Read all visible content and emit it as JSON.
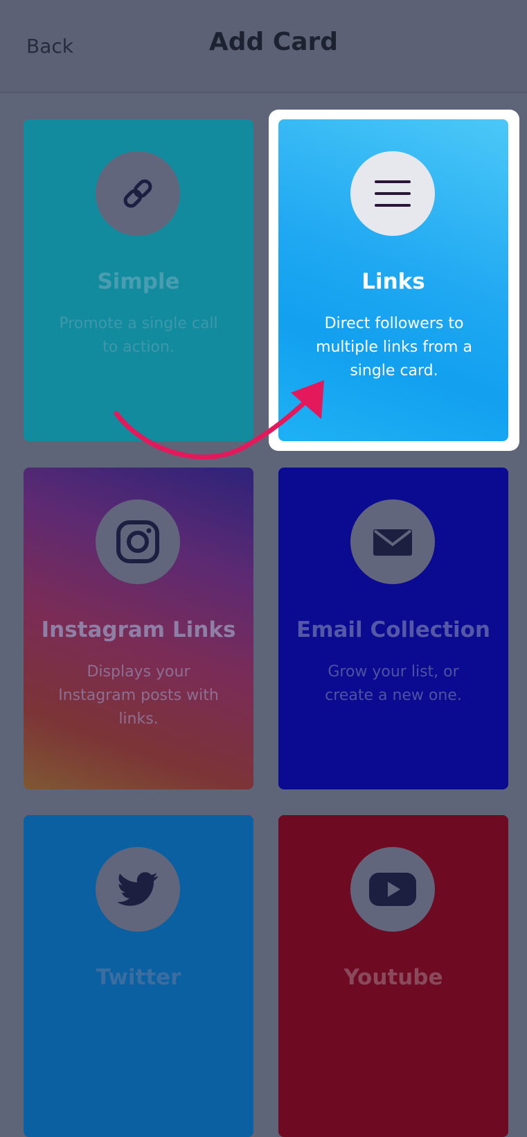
{
  "header": {
    "back_label": "Back",
    "title": "Add Card"
  },
  "cards": {
    "simple": {
      "title": "Simple",
      "description": "Promote a single call to action.",
      "icon": "link-icon"
    },
    "links": {
      "title": "Links",
      "description": "Direct followers to multiple links from a single card.",
      "icon": "menu-lines-icon",
      "highlighted": true
    },
    "instagram": {
      "title": "Instagram Links",
      "description": "Displays your Instagram posts with links.",
      "icon": "instagram-icon"
    },
    "email": {
      "title": "Email Collection",
      "description": "Grow your list, or create a new one.",
      "icon": "envelope-icon"
    },
    "twitter": {
      "title": "Twitter",
      "icon": "twitter-bird-icon"
    },
    "youtube": {
      "title": "Youtube",
      "icon": "youtube-play-icon"
    }
  },
  "colors": {
    "overlay": "#5f6578",
    "highlight_border": "#ffffff",
    "arrow": "#e3195c",
    "links_card": "#21a9f2"
  }
}
